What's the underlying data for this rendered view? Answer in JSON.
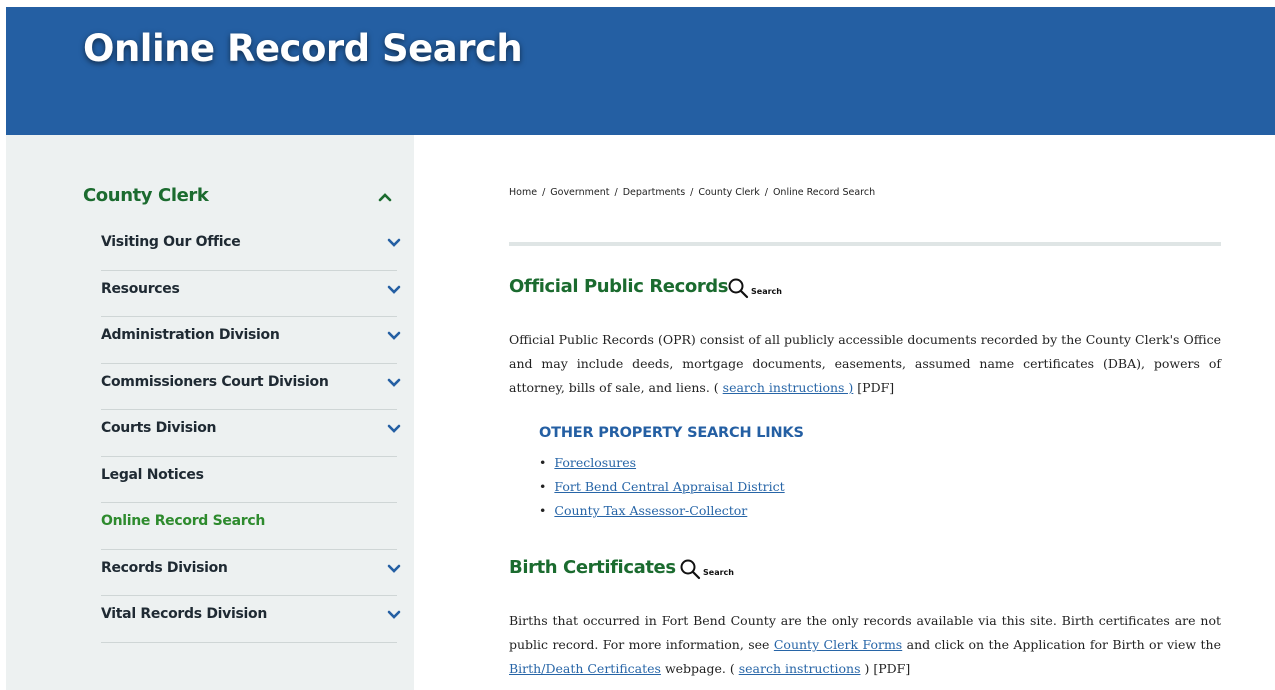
{
  "banner": {
    "title": "Online Record Search"
  },
  "sidebar": {
    "heading": "County Clerk",
    "items": [
      {
        "label": "Visiting Our Office",
        "expandable": true
      },
      {
        "label": "Resources",
        "expandable": true
      },
      {
        "label": "Administration Division",
        "expandable": true
      },
      {
        "label": "Commissioners Court Division",
        "expandable": true
      },
      {
        "label": "Courts Division",
        "expandable": true
      },
      {
        "label": "Legal Notices",
        "expandable": false
      },
      {
        "label": "Online Record Search",
        "expandable": false,
        "active": true
      },
      {
        "label": "Records Division",
        "expandable": true
      },
      {
        "label": "Vital Records Division",
        "expandable": true
      }
    ]
  },
  "breadcrumb": [
    "Home",
    "Government",
    "Departments",
    "County Clerk",
    "Online Record Search"
  ],
  "opr": {
    "title": "Official Public Records",
    "search_label": "Search",
    "text": "Official Public Records (OPR) consist of all publicly accessible documents recorded by the County Clerk's Office and may include deeds, mortgage documents, easements, assumed name certificates (DBA), powers of attorney, bills of sale, and liens. (",
    "instructions_link": "search instructions )",
    "pdf": "[PDF]"
  },
  "other_links": {
    "heading": "OTHER PROPERTY SEARCH LINKS",
    "items": [
      "Foreclosures",
      "Fort Bend Central Appraisal District",
      "County Tax Assessor-Collector"
    ]
  },
  "birth": {
    "title": "Birth Certificates",
    "search_label": "Search",
    "text1": "Births that occurred in Fort Bend County are the only records available via this site. Birth certificates are not public record. For more information, see",
    "forms_link": "County Clerk Forms",
    "text2": "and click on the Application for Birth or view the",
    "cert_link": "Birth/Death Certificates",
    "text3": "webpage. (",
    "instructions_link": "search instructions",
    "text4": ") [PDF]"
  },
  "colors": {
    "banner": "#245fa3",
    "heading_green": "#1b6b2f",
    "active_green": "#2e8b2e",
    "link_blue": "#2765a7",
    "sidebar_bg": "#edf1f1"
  }
}
